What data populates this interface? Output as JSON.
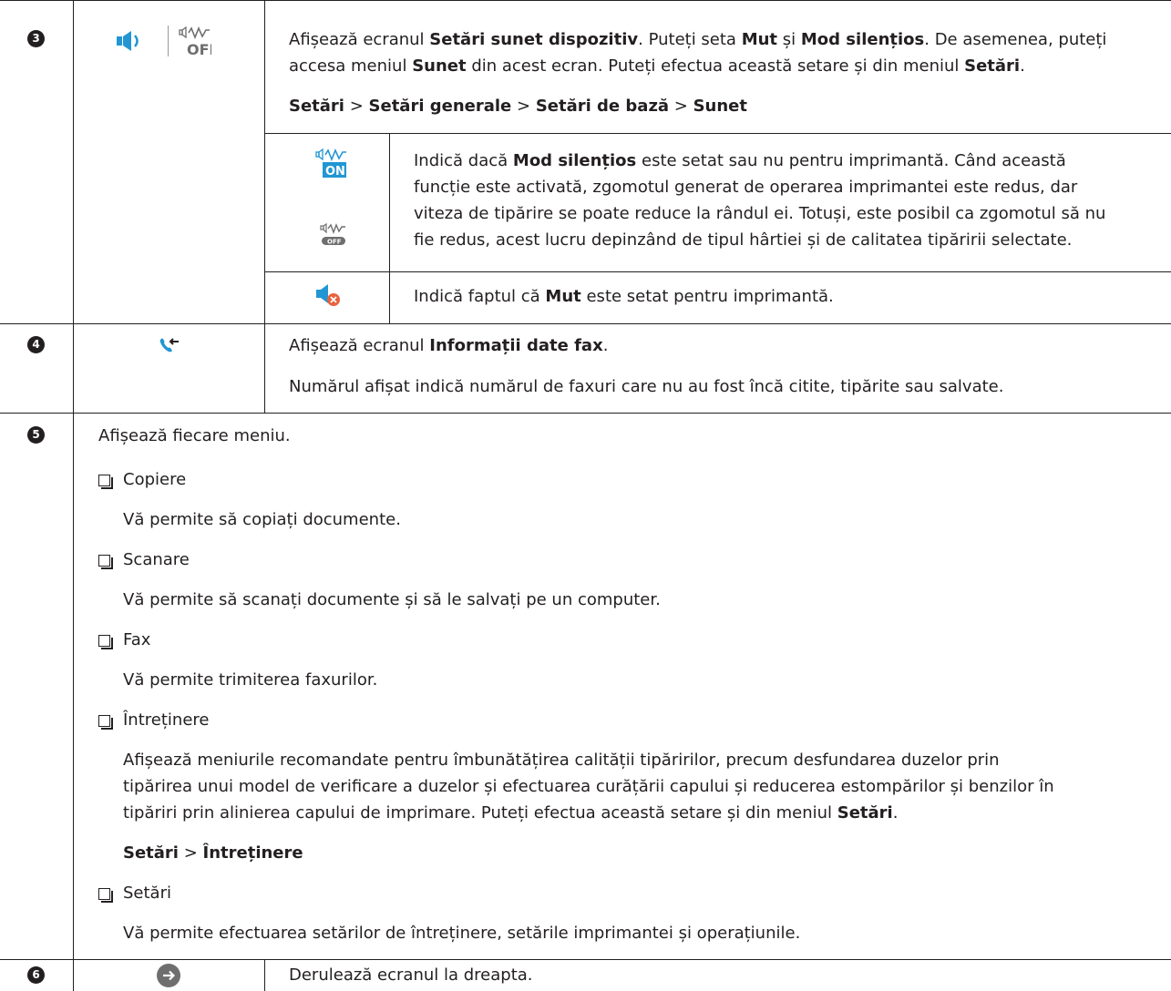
{
  "colors": {
    "text": "#231f20",
    "blue": "#2196d3",
    "grey_icon": "#6e6e6e",
    "mute_red": "#e8623c"
  },
  "rows": {
    "r3": {
      "num": "3",
      "icon_names": [
        "speaker-icon",
        "silent-mode-off-icon"
      ],
      "p1": [
        "Afișează ecranul ",
        "Setări sunet dispozitiv",
        ". Puteți seta ",
        "Mut",
        " și ",
        "Mod silențios",
        ". De asemenea, puteți"
      ],
      "p2": [
        "accesa meniul ",
        "Sunet",
        " din acest ecran. Puteți efectua această setare și din meniul ",
        "Setări",
        "."
      ],
      "path": [
        "Setări",
        " > ",
        "Setări generale",
        " > ",
        "Setări de bază",
        " > ",
        "Sunet"
      ],
      "sub1_icons": {
        "on_label": "ON",
        "off_label": "OFF"
      },
      "sub1_lines": [
        [
          "Indică dacă ",
          "Mod silențios",
          " este setat sau nu pentru imprimantă. Când această"
        ],
        [
          "funcție este activată, zgomotul generat de operarea imprimantei este redus, dar"
        ],
        [
          "viteza de tipărire se poate reduce la rândul ei. Totuși, este posibil ca zgomotul să nu"
        ],
        [
          "fie redus, acest lucru depinzând de tipul hârtiei și de calitatea tipăririi selectate."
        ]
      ],
      "sub2_line": [
        "Indică faptul că ",
        "Mut",
        " este setat pentru imprimantă."
      ]
    },
    "r4": {
      "num": "4",
      "icon_name": "fax-info-icon",
      "p1": [
        "Afișează ecranul ",
        "Informații date fax",
        "."
      ],
      "p2": "Numărul afișat indică numărul de faxuri care nu au fost încă citite, tipărite sau salvate."
    },
    "r5": {
      "num": "5",
      "intro": "Afișează fiecare meniu.",
      "items": [
        {
          "label": "Copiere",
          "desc": "Vă permite să copiați documente."
        },
        {
          "label": "Scanare",
          "desc": "Vă permite să scanați documente și să le salvați pe un computer."
        },
        {
          "label": "Fax",
          "desc": "Vă permite trimiterea faxurilor."
        },
        {
          "label": "Întreținere"
        },
        {
          "label": "Setări",
          "desc": "Vă permite efectuarea setărilor de întreținere, setările imprimantei și operațiunile."
        }
      ],
      "maint_lines": [
        "Afișează meniurile recomandate pentru îmbunătățirea calității tipăririlor, precum desfundarea duzelor prin",
        "tipărirea unui model de verificare a duzelor și efectuarea curățării capului și reducerea estompărilor și benzilor în"
      ],
      "maint_line3": [
        "tipăriri prin alinierea capului de imprimare. Puteți efectua această setare și din meniul ",
        "Setări",
        "."
      ],
      "maint_path": [
        "Setări",
        " > ",
        "Întreținere"
      ]
    },
    "r6": {
      "num": "6",
      "icon_name": "scroll-right-icon",
      "text": "Derulează ecranul la dreapta."
    }
  }
}
